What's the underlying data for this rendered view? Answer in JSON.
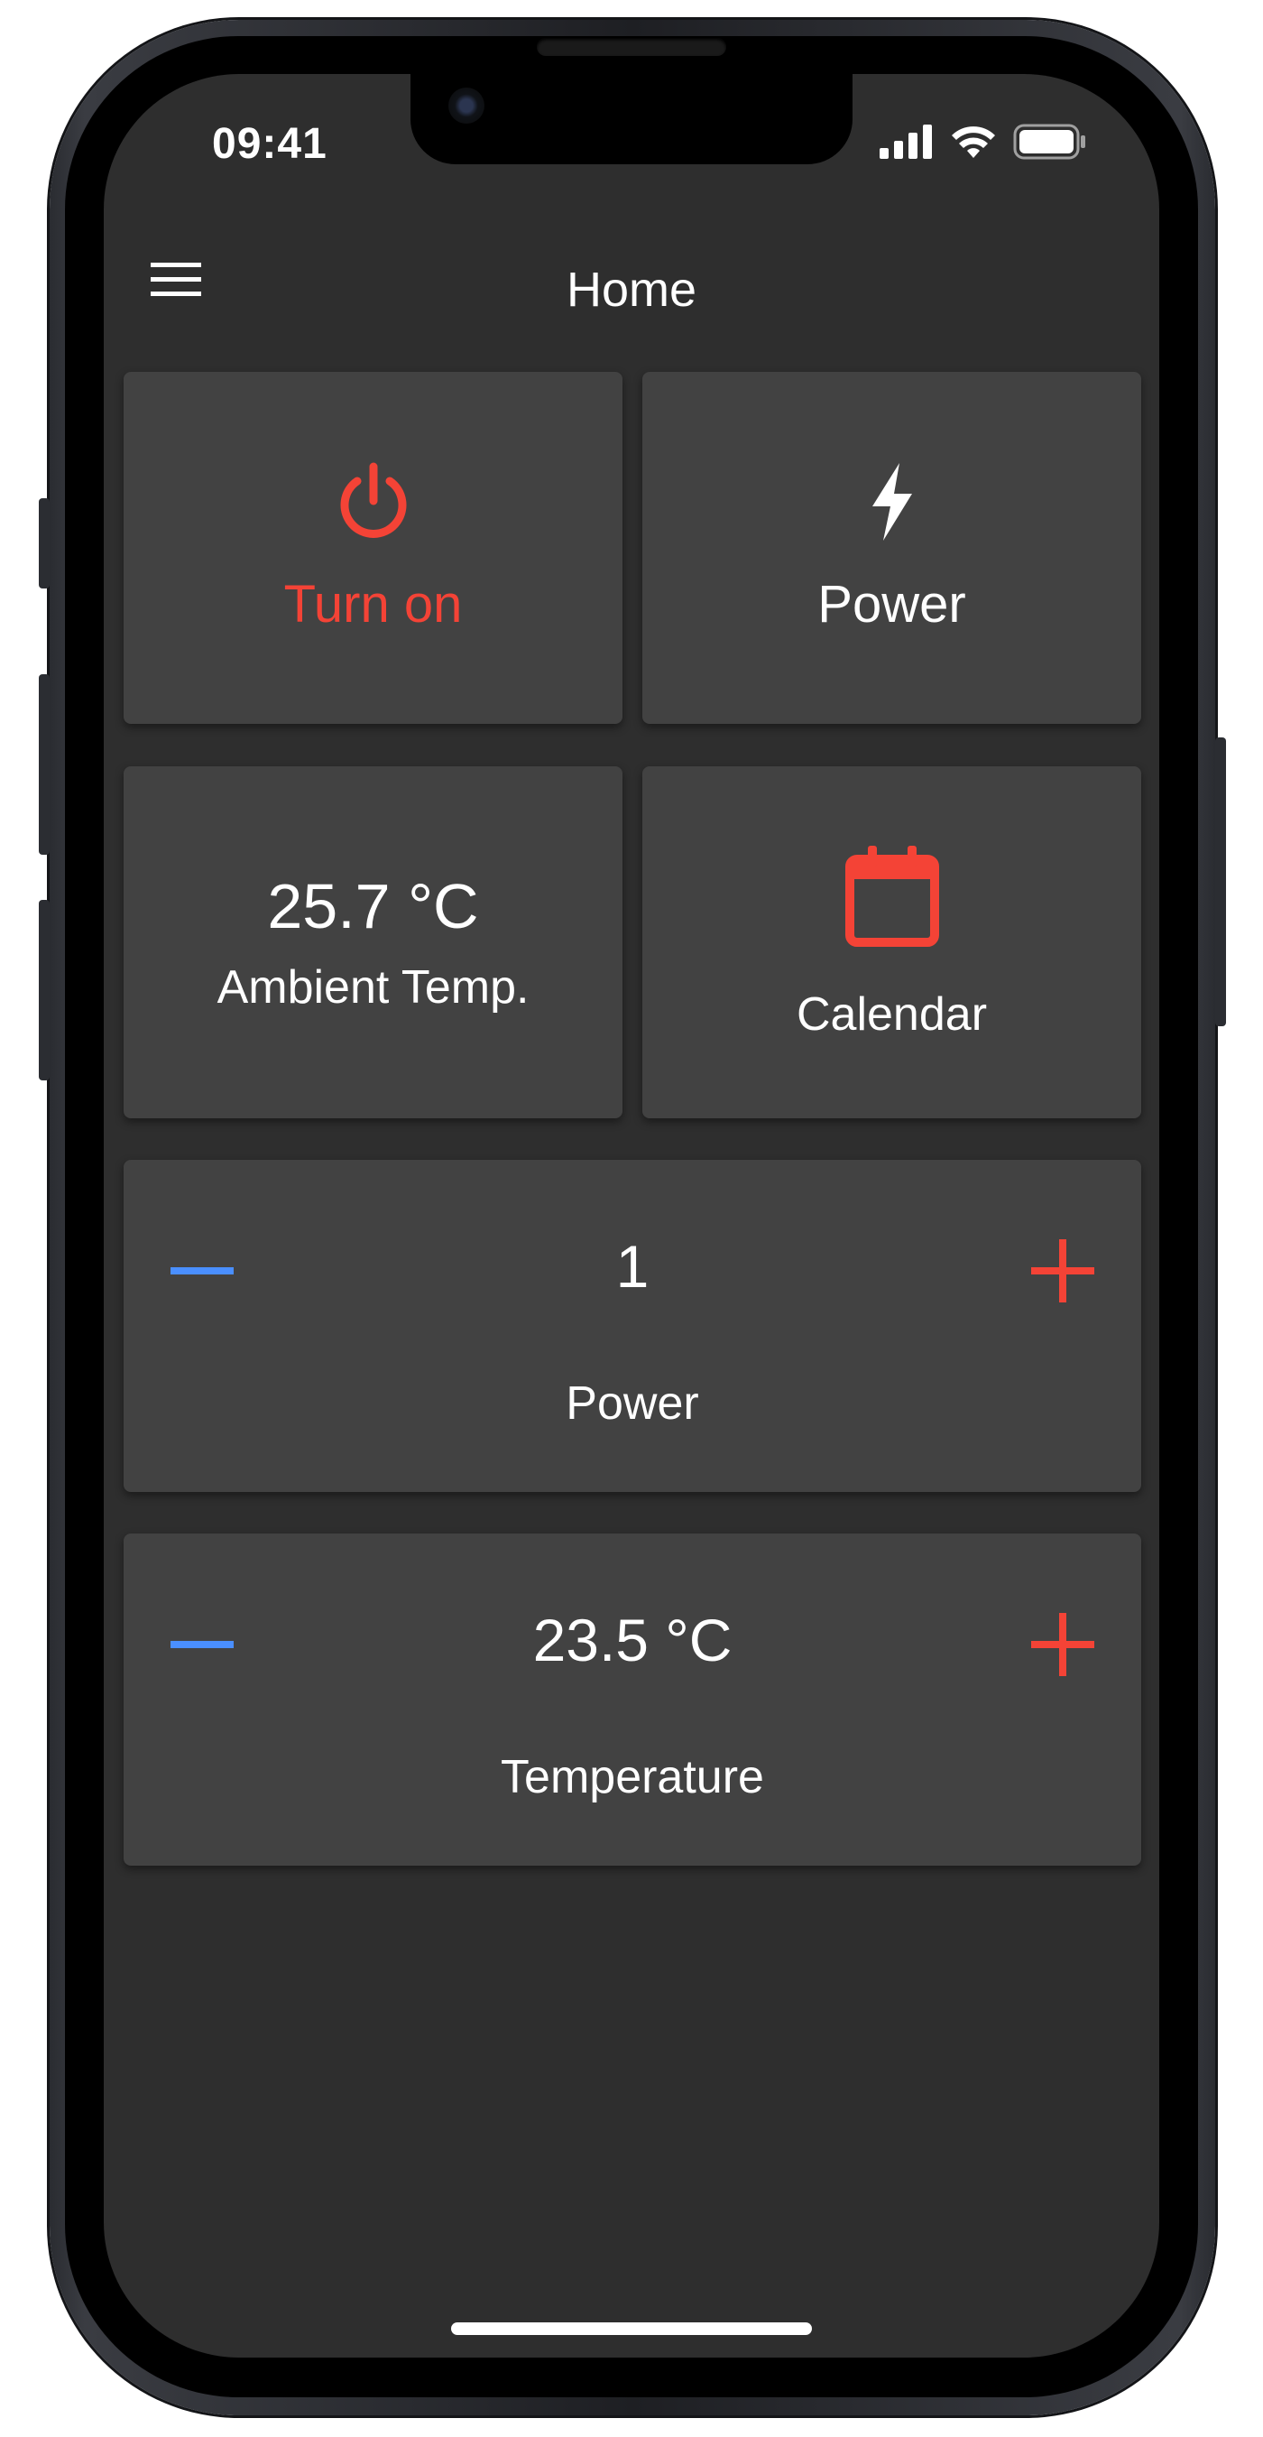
{
  "status_bar": {
    "time": "09:41"
  },
  "app_bar": {
    "title": "Home",
    "menu_icon": "menu-icon"
  },
  "tiles": {
    "turn_on": {
      "label": "Turn on",
      "icon": "power-icon",
      "color": "#f44336"
    },
    "power": {
      "label": "Power",
      "icon": "bolt-icon",
      "color": "#ffffff"
    },
    "ambient": {
      "value": "25.7 °C",
      "label": "Ambient Temp."
    },
    "calendar": {
      "label": "Calendar",
      "icon": "calendar-icon",
      "color": "#f44336"
    }
  },
  "steppers": {
    "power": {
      "value": "1",
      "label": "Power",
      "decrement_color": "#4a8fff",
      "increment_color": "#f44336"
    },
    "temperature": {
      "value": "23.5 °C",
      "label": "Temperature",
      "decrement_color": "#4a8fff",
      "increment_color": "#f44336"
    }
  },
  "colors": {
    "background": "#2e2e2e",
    "card": "#424242",
    "accent_red": "#f44336",
    "accent_blue": "#4a8fff"
  }
}
